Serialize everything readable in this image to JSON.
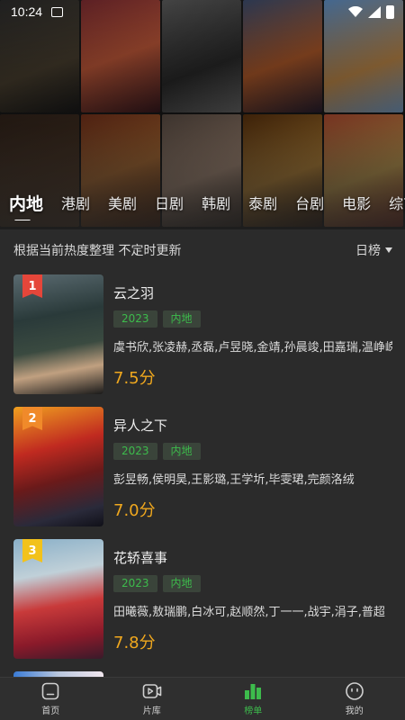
{
  "status_bar": {
    "time": "10:24"
  },
  "category_tabs": [
    "内地",
    "港剧",
    "美剧",
    "日剧",
    "韩剧",
    "泰剧",
    "台剧",
    "电影",
    "综艺"
  ],
  "active_tab_index": 0,
  "subheader": {
    "text": "根据当前热度整理 不定时更新",
    "sort_label": "日榜"
  },
  "items": [
    {
      "rank": "1",
      "title": "云之羽",
      "year": "2023",
      "region": "内地",
      "cast": "虞书欣,张凌赫,丞磊,卢昱晓,金靖,孙晨竣,田嘉瑞,温峥嵘",
      "score": "7.5分",
      "rank_color": "#e5463a"
    },
    {
      "rank": "2",
      "title": "异人之下",
      "year": "2023",
      "region": "内地",
      "cast": "彭昱畅,侯明昊,王影璐,王学圻,毕雯珺,完颜洛绒",
      "score": "7.0分",
      "rank_color": "#f08a2a"
    },
    {
      "rank": "3",
      "title": "花轿喜事",
      "year": "2023",
      "region": "内地",
      "cast": "田曦薇,敖瑞鹏,白冰可,赵顺然,丁一一,战宇,涓子,普超",
      "score": "7.8分",
      "rank_color": "#f2c21b"
    }
  ],
  "bottom_nav": [
    {
      "label": "首页",
      "icon": "home-icon"
    },
    {
      "label": "片库",
      "icon": "video-library-icon"
    },
    {
      "label": "榜单",
      "icon": "ranking-icon"
    },
    {
      "label": "我的",
      "icon": "profile-icon"
    }
  ],
  "active_nav_index": 2,
  "colors": {
    "accent": "#3dbb4c",
    "score": "#f0a81e",
    "background": "#2b2b2b"
  }
}
